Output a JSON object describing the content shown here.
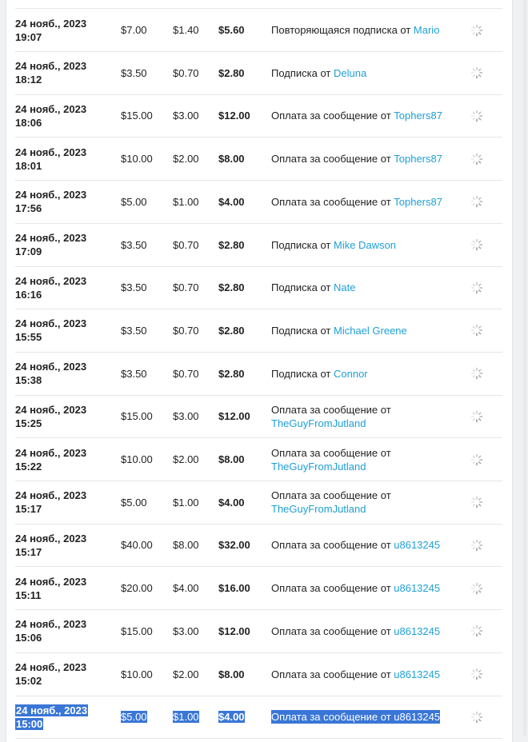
{
  "earnings": {
    "rows": [
      {
        "date_line1": "24 нояб., 2023",
        "date_line2": "19:07",
        "gross": "$7.00",
        "fee": "$1.40",
        "net": "$5.60",
        "desc_prefix": "Повторяющаяся подписка от ",
        "user": "Mario",
        "icon": "loading-spinner-icon"
      },
      {
        "date_line1": "24 нояб., 2023",
        "date_line2": "18:12",
        "gross": "$3.50",
        "fee": "$0.70",
        "net": "$2.80",
        "desc_prefix": "Подписка от ",
        "user": "Deluna",
        "icon": "loading-spinner-icon"
      },
      {
        "date_line1": "24 нояб., 2023",
        "date_line2": "18:06",
        "gross": "$15.00",
        "fee": "$3.00",
        "net": "$12.00",
        "desc_prefix": "Оплата за сообщение от ",
        "user": "Tophers87",
        "icon": "loading-spinner-icon"
      },
      {
        "date_line1": "24 нояб., 2023",
        "date_line2": "18:01",
        "gross": "$10.00",
        "fee": "$2.00",
        "net": "$8.00",
        "desc_prefix": "Оплата за сообщение от ",
        "user": "Tophers87",
        "icon": "loading-spinner-icon"
      },
      {
        "date_line1": "24 нояб., 2023",
        "date_line2": "17:56",
        "gross": "$5.00",
        "fee": "$1.00",
        "net": "$4.00",
        "desc_prefix": "Оплата за сообщение от ",
        "user": "Tophers87",
        "icon": "loading-spinner-icon"
      },
      {
        "date_line1": "24 нояб., 2023",
        "date_line2": "17:09",
        "gross": "$3.50",
        "fee": "$0.70",
        "net": "$2.80",
        "desc_prefix": "Подписка от ",
        "user": "Mike Dawson",
        "icon": "loading-spinner-icon"
      },
      {
        "date_line1": "24 нояб., 2023",
        "date_line2": "16:16",
        "gross": "$3.50",
        "fee": "$0.70",
        "net": "$2.80",
        "desc_prefix": "Подписка от ",
        "user": "Nate",
        "icon": "loading-spinner-icon"
      },
      {
        "date_line1": "24 нояб., 2023",
        "date_line2": "15:55",
        "gross": "$3.50",
        "fee": "$0.70",
        "net": "$2.80",
        "desc_prefix": "Подписка от ",
        "user": "Michael Greene",
        "icon": "loading-spinner-icon"
      },
      {
        "date_line1": "24 нояб., 2023",
        "date_line2": "15:38",
        "gross": "$3.50",
        "fee": "$0.70",
        "net": "$2.80",
        "desc_prefix": "Подписка от ",
        "user": "Connor",
        "icon": "loading-spinner-icon"
      },
      {
        "date_line1": "24 нояб., 2023",
        "date_line2": "15:25",
        "gross": "$15.00",
        "fee": "$3.00",
        "net": "$12.00",
        "desc_prefix": "Оплата за сообщение от ",
        "user": "TheGuyFromJutland",
        "icon": "loading-spinner-icon"
      },
      {
        "date_line1": "24 нояб., 2023",
        "date_line2": "15:22",
        "gross": "$10.00",
        "fee": "$2.00",
        "net": "$8.00",
        "desc_prefix": "Оплата за сообщение от ",
        "user": "TheGuyFromJutland",
        "icon": "loading-spinner-icon"
      },
      {
        "date_line1": "24 нояб., 2023",
        "date_line2": "15:17",
        "gross": "$5.00",
        "fee": "$1.00",
        "net": "$4.00",
        "desc_prefix": "Оплата за сообщение от ",
        "user": "TheGuyFromJutland",
        "icon": "loading-spinner-icon"
      },
      {
        "date_line1": "24 нояб., 2023",
        "date_line2": "15:17",
        "gross": "$40.00",
        "fee": "$8.00",
        "net": "$32.00",
        "desc_prefix": "Оплата за сообщение от ",
        "user": "u8613245",
        "icon": "loading-spinner-icon"
      },
      {
        "date_line1": "24 нояб., 2023",
        "date_line2": "15:11",
        "gross": "$20.00",
        "fee": "$4.00",
        "net": "$16.00",
        "desc_prefix": "Оплата за сообщение от ",
        "user": "u8613245",
        "icon": "loading-spinner-icon"
      },
      {
        "date_line1": "24 нояб., 2023",
        "date_line2": "15:06",
        "gross": "$15.00",
        "fee": "$3.00",
        "net": "$12.00",
        "desc_prefix": "Оплата за сообщение от ",
        "user": "u8613245",
        "icon": "loading-spinner-icon"
      },
      {
        "date_line1": "24 нояб., 2023",
        "date_line2": "15:02",
        "gross": "$10.00",
        "fee": "$2.00",
        "net": "$8.00",
        "desc_prefix": "Оплата за сообщение от ",
        "user": "u8613245",
        "icon": "loading-spinner-icon"
      },
      {
        "date_line1": "24 нояб., 2023",
        "date_line2": "15:00",
        "gross": "$5.00",
        "fee": "$1.00",
        "net": "$4.00",
        "desc_prefix": "Оплата за сообщение от ",
        "user": "u8613245",
        "icon": "loading-spinner-icon",
        "selected": true
      }
    ]
  },
  "colors": {
    "link": "#1fa0d6",
    "selection": "#3a76d6",
    "divider": "#e6e6e6",
    "page_bg": "#f0f1f3"
  }
}
